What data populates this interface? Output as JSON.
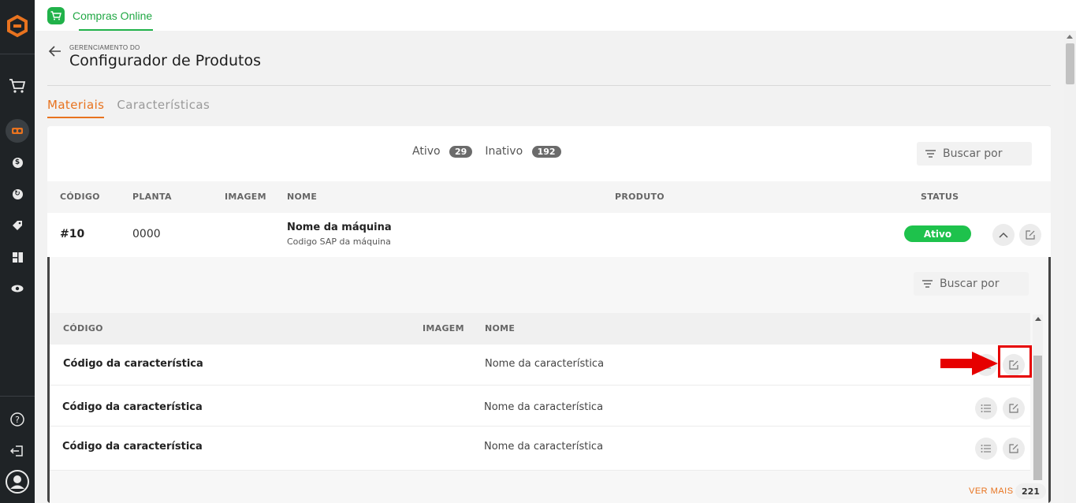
{
  "app": {
    "title": "Compras Online"
  },
  "header": {
    "kicker": "GERENCIAMENTO DO",
    "title": "Configurador de Produtos"
  },
  "tabs": [
    {
      "label": "Materiais",
      "active": true
    },
    {
      "label": "Características",
      "active": false
    }
  ],
  "filters": {
    "ativo_label": "Ativo",
    "ativo_count": "29",
    "inativo_label": "Inativo",
    "inativo_count": "192"
  },
  "search": {
    "placeholder": "Buscar por"
  },
  "table": {
    "columns": [
      "CÓDIGO",
      "PLANTA",
      "IMAGEM",
      "NOME",
      "PRODUTO",
      "STATUS"
    ],
    "row": {
      "code": "#10",
      "planta": "0000",
      "name": "Nome da máquina",
      "subtitle": "Codigo SAP da máquina",
      "status": "Ativo"
    }
  },
  "sub_table": {
    "search_placeholder": "Buscar por",
    "columns": [
      "CÓDIGO",
      "IMAGEM",
      "NOME"
    ],
    "rows": [
      {
        "code": "Código da característica",
        "name": "Nome da característica"
      },
      {
        "code": "Código da característica",
        "name": "Nome da característica"
      },
      {
        "code": "Código da característica",
        "name": "Nome da característica"
      }
    ]
  },
  "footer": {
    "ver_mais": "VER MAIS",
    "total": "221"
  },
  "colors": {
    "accent": "#e8731f",
    "brand_green": "#21b24a",
    "status_green": "#1ec24c",
    "annotation_red": "#e60000",
    "sidebar_bg": "#1f2326"
  },
  "icons": [
    "logo-icon",
    "cart-icon",
    "config-icon",
    "dollar-icon",
    "refresh-dollar-icon",
    "tag-icon",
    "grid-icon",
    "eye-icon",
    "help-icon",
    "logout-icon",
    "user-icon",
    "back-arrow-icon",
    "filter-lines-icon",
    "chevron-up-icon",
    "edit-icon",
    "list-icon"
  ]
}
